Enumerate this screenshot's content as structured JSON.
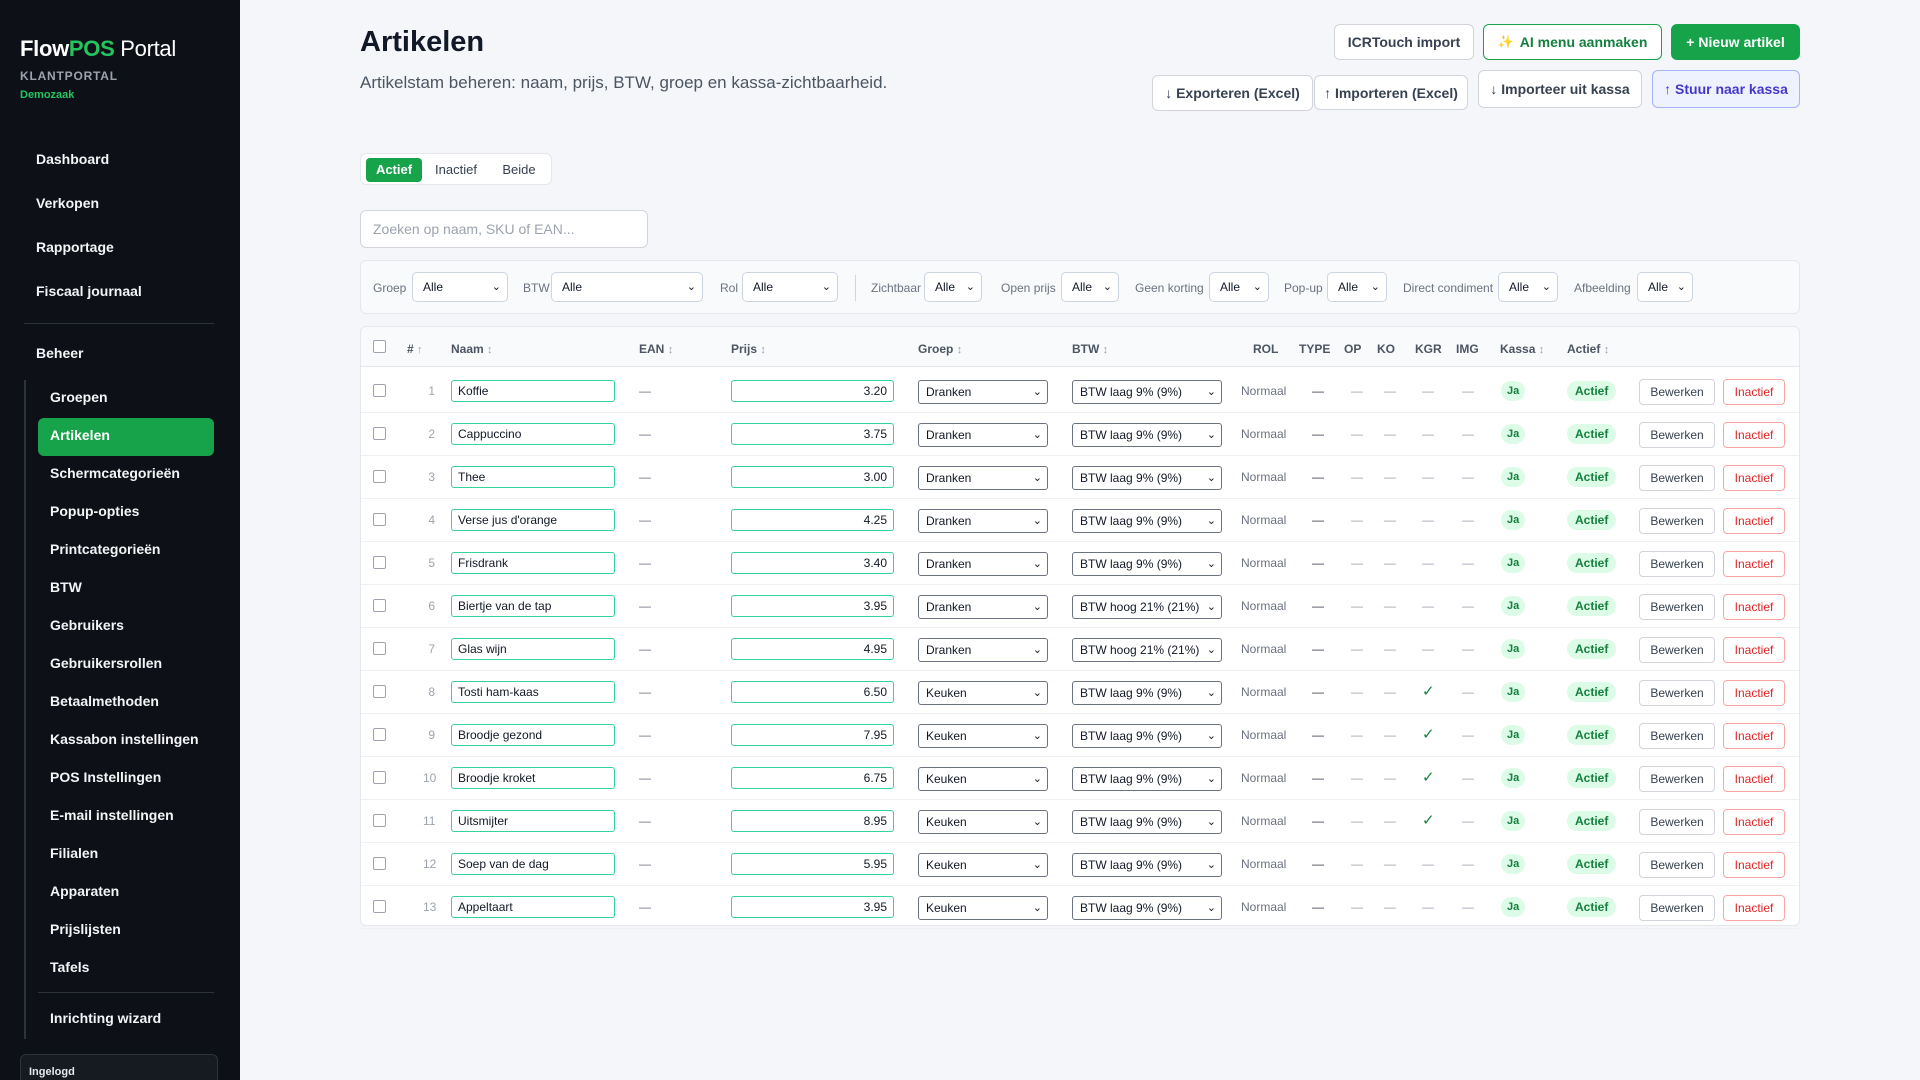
{
  "brand": {
    "flow": "Flow",
    "pos": "POS",
    "portal": "Portal",
    "subtitle": "KLANTPORTAL",
    "shop": "Demozaak"
  },
  "nav": {
    "top": [
      "Dashboard",
      "Verkopen",
      "Rapportage",
      "Fiscaal journaal"
    ],
    "section": "Beheer",
    "sub": [
      "Groepen",
      "Artikelen",
      "Schermcategorieën",
      "Popup-opties",
      "Printcategorieën",
      "BTW",
      "Gebruikers",
      "Gebruikersrollen",
      "Betaalmethoden",
      "Kassabon instellingen",
      "POS Instellingen",
      "E-mail instellingen",
      "Filialen",
      "Apparaten",
      "Prijslijsten",
      "Tafels"
    ],
    "active": "Artikelen",
    "wizard": "Inrichting wizard",
    "login": "Ingelogd"
  },
  "page": {
    "title": "Artikelen",
    "subtitle": "Artikelstam beheren: naam, prijs, BTW, groep en kassa-zichtbaarheid."
  },
  "actions": {
    "icr": "ICRTouch import",
    "ai": "AI menu aanmaken",
    "new": "+ Nieuw artikel",
    "export": "↓ Exporteren (Excel)",
    "import": "↑ Importeren (Excel)",
    "import_kassa": "↓ Importeer uit kassa",
    "send_kassa": "↑ Stuur naar kassa"
  },
  "status_tabs": [
    "Actief",
    "Inactief",
    "Beide"
  ],
  "status_selected": "Actief",
  "search": {
    "placeholder": "Zoeken op naam, SKU of EAN..."
  },
  "filters": [
    {
      "label": "Groep",
      "value": "Alle"
    },
    {
      "label": "BTW",
      "value": "Alle"
    },
    {
      "label": "Rol",
      "value": "Alle"
    },
    {
      "label": "Zichtbaar",
      "value": "Alle"
    },
    {
      "label": "Open prijs",
      "value": "Alle"
    },
    {
      "label": "Geen korting",
      "value": "Alle"
    },
    {
      "label": "Pop-up",
      "value": "Alle"
    },
    {
      "label": "Direct condiment",
      "value": "Alle"
    },
    {
      "label": "Afbeelding",
      "value": "Alle"
    }
  ],
  "table": {
    "columns": {
      "num": "#",
      "name": "Naam",
      "ean": "EAN",
      "price": "Prijs",
      "group": "Groep",
      "btw": "BTW",
      "rol": "ROL",
      "type": "TYPE",
      "op": "OP",
      "ko": "KO",
      "kgr": "KGR",
      "img": "IMG",
      "kassa": "Kassa",
      "actief": "Actief"
    },
    "sort_default": "↑",
    "sort_icon": "↕",
    "dash": "—",
    "edit_label": "Bewerken",
    "deactivate_label": "Inactief",
    "rows": [
      {
        "num": "1",
        "name": "Koffie",
        "ean": "—",
        "price": "3.20",
        "group": "Dranken",
        "btw": "BTW laag 9% (9%)",
        "rol": "Normaal",
        "kgr": "—",
        "kassa": "Ja",
        "actief": "Actief"
      },
      {
        "num": "2",
        "name": "Cappuccino",
        "ean": "—",
        "price": "3.75",
        "group": "Dranken",
        "btw": "BTW laag 9% (9%)",
        "rol": "Normaal",
        "kgr": "—",
        "kassa": "Ja",
        "actief": "Actief"
      },
      {
        "num": "3",
        "name": "Thee",
        "ean": "—",
        "price": "3.00",
        "group": "Dranken",
        "btw": "BTW laag 9% (9%)",
        "rol": "Normaal",
        "kgr": "—",
        "kassa": "Ja",
        "actief": "Actief"
      },
      {
        "num": "4",
        "name": "Verse jus d'orange",
        "ean": "—",
        "price": "4.25",
        "group": "Dranken",
        "btw": "BTW laag 9% (9%)",
        "rol": "Normaal",
        "kgr": "—",
        "kassa": "Ja",
        "actief": "Actief"
      },
      {
        "num": "5",
        "name": "Frisdrank",
        "ean": "—",
        "price": "3.40",
        "group": "Dranken",
        "btw": "BTW laag 9% (9%)",
        "rol": "Normaal",
        "kgr": "—",
        "kassa": "Ja",
        "actief": "Actief"
      },
      {
        "num": "6",
        "name": "Biertje van de tap",
        "ean": "—",
        "price": "3.95",
        "group": "Dranken",
        "btw": "BTW hoog 21% (21%)",
        "rol": "Normaal",
        "kgr": "—",
        "kassa": "Ja",
        "actief": "Actief"
      },
      {
        "num": "7",
        "name": "Glas wijn",
        "ean": "—",
        "price": "4.95",
        "group": "Dranken",
        "btw": "BTW hoog 21% (21%)",
        "rol": "Normaal",
        "kgr": "—",
        "kassa": "Ja",
        "actief": "Actief"
      },
      {
        "num": "8",
        "name": "Tosti ham-kaas",
        "ean": "—",
        "price": "6.50",
        "group": "Keuken",
        "btw": "BTW laag 9% (9%)",
        "rol": "Normaal",
        "kgr": "✓",
        "kassa": "Ja",
        "actief": "Actief"
      },
      {
        "num": "9",
        "name": "Broodje gezond",
        "ean": "—",
        "price": "7.95",
        "group": "Keuken",
        "btw": "BTW laag 9% (9%)",
        "rol": "Normaal",
        "kgr": "✓",
        "kassa": "Ja",
        "actief": "Actief"
      },
      {
        "num": "10",
        "name": "Broodje kroket",
        "ean": "—",
        "price": "6.75",
        "group": "Keuken",
        "btw": "BTW laag 9% (9%)",
        "rol": "Normaal",
        "kgr": "✓",
        "kassa": "Ja",
        "actief": "Actief"
      },
      {
        "num": "11",
        "name": "Uitsmijter",
        "ean": "—",
        "price": "8.95",
        "group": "Keuken",
        "btw": "BTW laag 9% (9%)",
        "rol": "Normaal",
        "kgr": "✓",
        "kassa": "Ja",
        "actief": "Actief"
      },
      {
        "num": "12",
        "name": "Soep van de dag",
        "ean": "—",
        "price": "5.95",
        "group": "Keuken",
        "btw": "BTW laag 9% (9%)",
        "rol": "Normaal",
        "kgr": "—",
        "kassa": "Ja",
        "actief": "Actief"
      },
      {
        "num": "13",
        "name": "Appeltaart",
        "ean": "—",
        "price": "3.95",
        "group": "Keuken",
        "btw": "BTW laag 9% (9%)",
        "rol": "Normaal",
        "kgr": "—",
        "kassa": "Ja",
        "actief": "Actief"
      }
    ]
  },
  "colors": {
    "accent": "#16a34a",
    "sidebar": "#0d1117",
    "danger": "#dc2626",
    "indigo": "#4338ca"
  }
}
